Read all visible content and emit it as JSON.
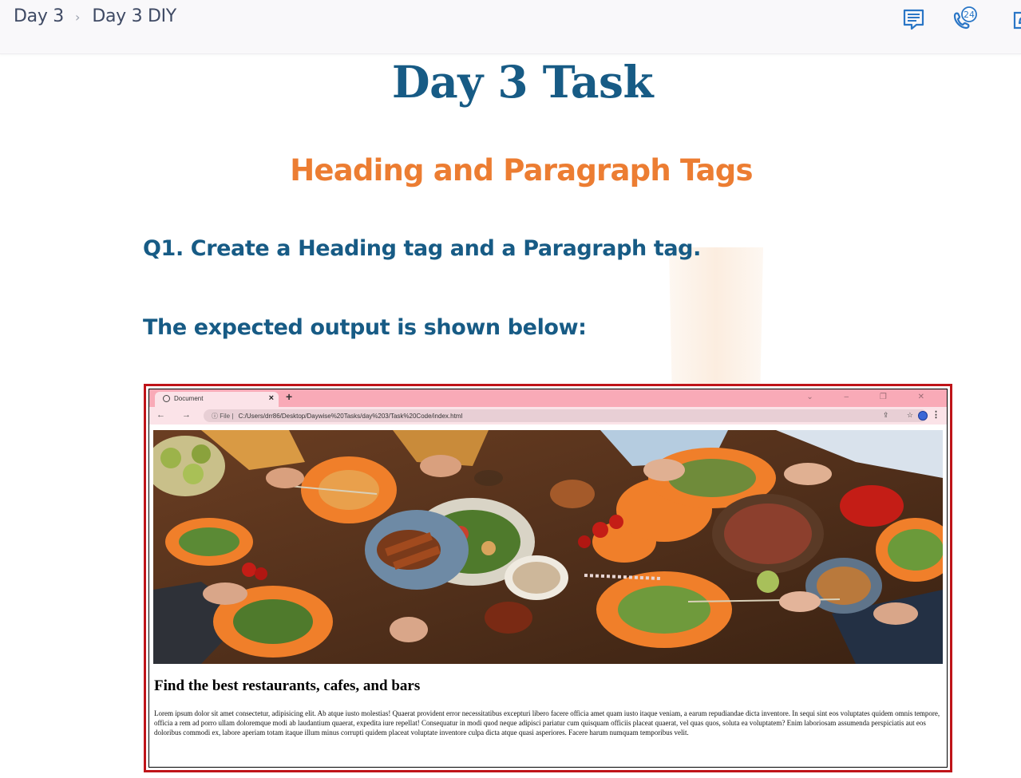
{
  "breadcrumb": {
    "items": [
      "Day 3",
      "Day 3 DIY"
    ],
    "separator": "›"
  },
  "toolbar": {
    "icons": [
      "chat-icon",
      "support-24-icon",
      "edit-icon"
    ],
    "support_badge": "24"
  },
  "document": {
    "title": "Day 3 Task",
    "subtitle": "Heading and Paragraph Tags",
    "question": "Q1. Create a Heading tag and a Paragraph tag.",
    "expected_note": "The expected output is shown below:"
  },
  "screenshot": {
    "tab_title": "Document",
    "tab_close": "×",
    "new_tab": "+",
    "window_controls": "⌄ – ❐ ✕",
    "nav_controls": "← → C",
    "address_prefix": "ⓘ File |",
    "address": "C:/Users/drr86/Desktop/Daywise%20Tasks/day%203/Task%20Code/index.html",
    "omni_icons": "⇪ ☆",
    "menu_icon": "⋮",
    "heading": "Find the best restaurants, cafes, and bars",
    "paragraph": "Lorem ipsum dolor sit amet consectetur, adipisicing elit. Ab atque iusto molestias! Quaerat provident error necessitatibus excepturi libero facere officia amet quam iusto itaque veniam, a earum repudiandae dicta inventore. In sequi sint eos voluptates quidem omnis tempore, officia a rem ad porro ullam doloremque modi ab laudantium quaerat, expedita iure repellat! Consequatur in modi quod neque adipisci pariatur cum quisquam officiis placeat quaerat, vel quas quos, soluta ea voluptatem? Enim laboriosam assumenda perspiciatis aut eos doloribus commodi ex, labore aperiam totam itaque illum minus corrupti quidem placeat voluptate inventore culpa dicta atque quasi asperiores. Facere harum numquam temporibus velit."
  },
  "colors": {
    "title": "#175b85",
    "subtitle": "#ec7d32",
    "frame_border": "#bf1419",
    "browser_tabbar": "#f9aab7"
  }
}
